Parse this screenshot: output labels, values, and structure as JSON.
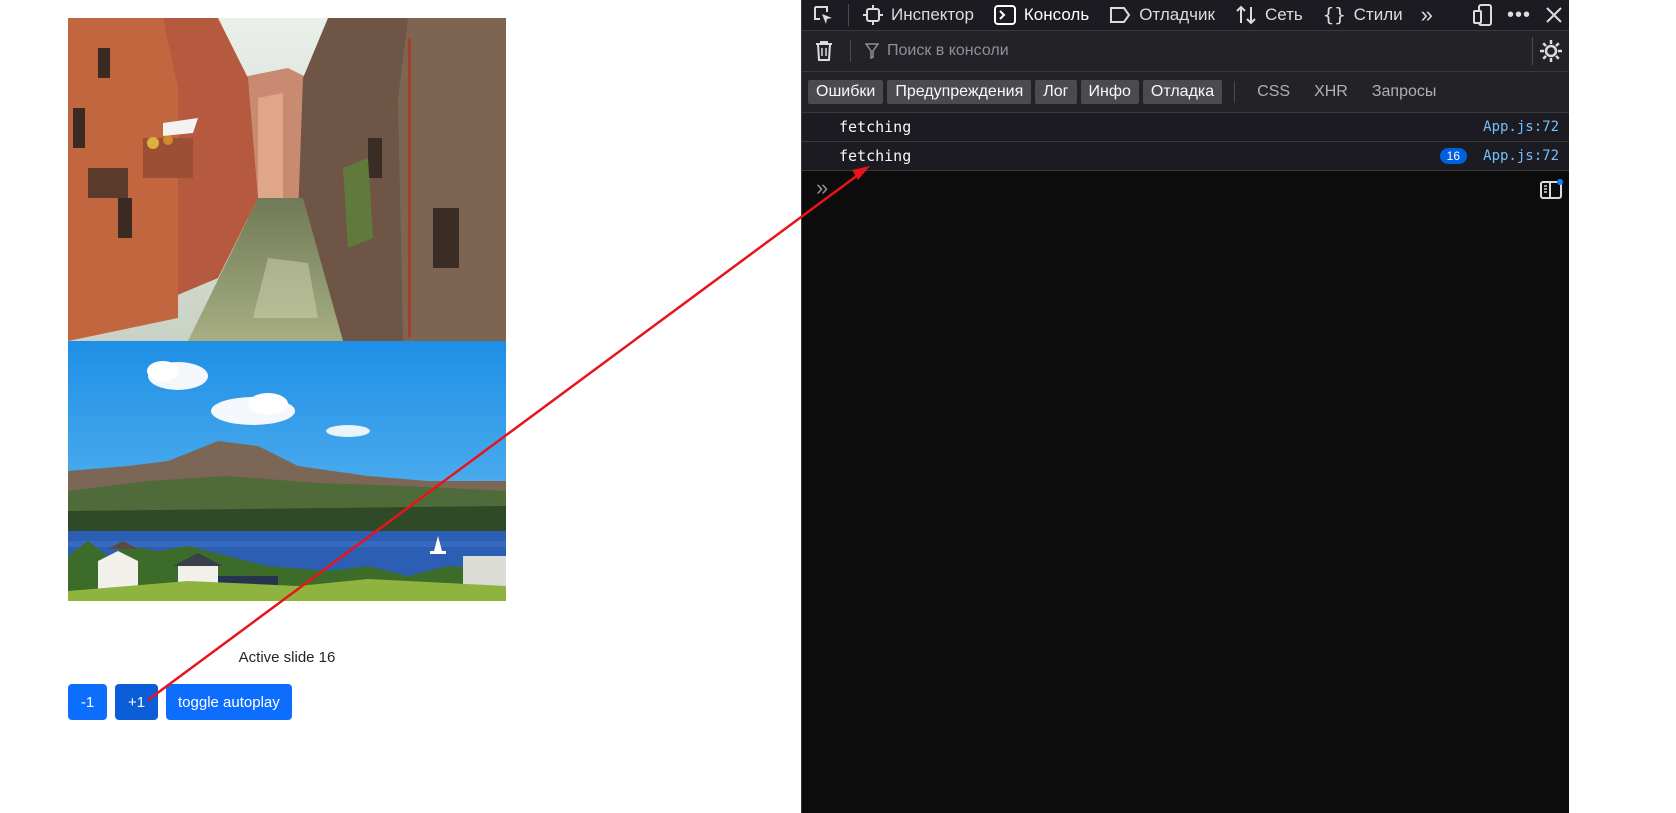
{
  "page": {
    "active_slide_text": "Active slide 16",
    "buttons": {
      "prev_label": "-1",
      "next_label": "+1",
      "autoplay_label": "toggle autoplay"
    },
    "colors": {
      "button": "#0d6efd"
    }
  },
  "devtools": {
    "tabs": [
      {
        "label": "Инспектор",
        "icon": "inspector-icon"
      },
      {
        "label": "Консоль",
        "icon": "console-icon",
        "active": true
      },
      {
        "label": "Отладчик",
        "icon": "debugger-icon"
      },
      {
        "label": "Сеть",
        "icon": "network-icon"
      },
      {
        "label": "Стили",
        "icon": "style-editor-icon"
      }
    ],
    "filter_placeholder": "Поиск в консоли",
    "levels": [
      "Ошибки",
      "Предупреждения",
      "Лог",
      "Инфо",
      "Отладка"
    ],
    "request_types": [
      "CSS",
      "XHR",
      "Запросы"
    ],
    "messages": [
      {
        "text": "fetching",
        "source": "App.js:72",
        "repeat": ""
      },
      {
        "text": "fetching",
        "source": "App.js:72",
        "repeat": "16"
      }
    ],
    "colors": {
      "background": "#0c0c0d",
      "source_link": "#75bfff",
      "badge": "#0060df",
      "annotation_arrow": "#e8141b"
    }
  }
}
